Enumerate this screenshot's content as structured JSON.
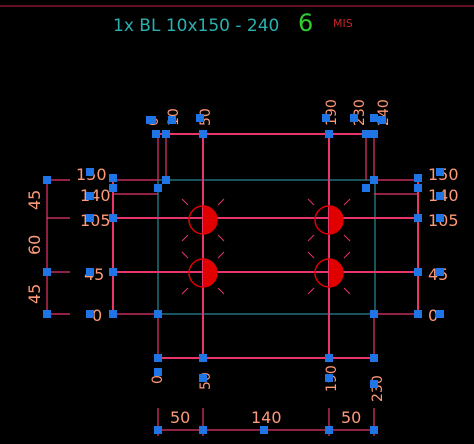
{
  "header": {
    "title": "1x BL 10x150 - 240",
    "count": "6",
    "unit": "MIS"
  },
  "dimensions": {
    "top": [
      "0",
      "10",
      "50",
      "190",
      "230",
      "240"
    ],
    "bottom": [
      "0",
      "50",
      "190",
      "230"
    ],
    "left_levels": [
      "150",
      "140",
      "105",
      "45",
      "0"
    ],
    "right_levels": [
      "150",
      "140",
      "105",
      "45",
      "0"
    ],
    "left_chain": [
      "45",
      "60",
      "45"
    ],
    "bottom_chain": [
      "50",
      "140",
      "50"
    ]
  },
  "colors": {
    "background": "#000000",
    "title": "#2bb0b0",
    "count": "#2fcc2f",
    "unit": "#c02828",
    "dimension_text": "#ff9a78",
    "frame_lines": "#e8366b",
    "inner_frame": "#2a8c9a",
    "grips": "#1f74e6",
    "anchor_markers": "#e00000"
  },
  "markers": {
    "icon": "half-filled-anchor-circle",
    "count": 4
  }
}
